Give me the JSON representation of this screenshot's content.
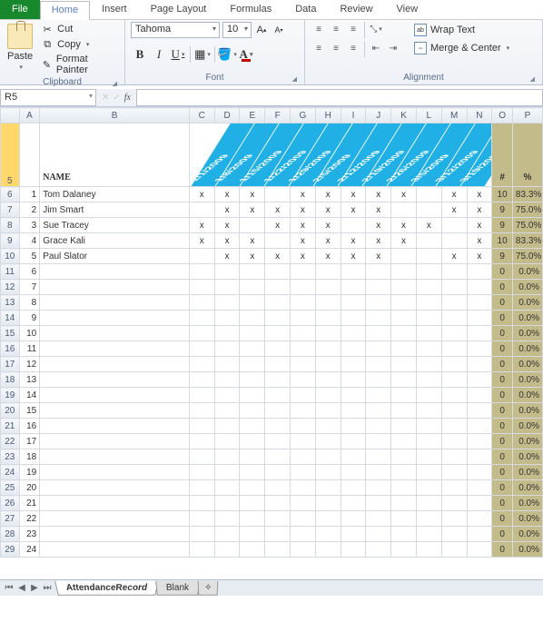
{
  "tabs": {
    "file": "File",
    "home": "Home",
    "insert": "Insert",
    "pagelayout": "Page Layout",
    "formulas": "Formulas",
    "data": "Data",
    "review": "Review",
    "view": "View"
  },
  "clipboard": {
    "paste": "Paste",
    "cut": "Cut",
    "copy": "Copy",
    "format_painter": "Format Painter",
    "group": "Clipboard"
  },
  "font": {
    "name": "Tahoma",
    "size": "10",
    "group": "Font",
    "grow": "A",
    "shrink": "A",
    "bold": "B",
    "italic": "I",
    "underline": "U"
  },
  "alignment": {
    "group": "Alignment",
    "wrap": "Wrap Text",
    "merge": "Merge & Center"
  },
  "namebox": "R5",
  "fx_label": "fx",
  "columns": [
    "A",
    "B",
    "C",
    "D",
    "E",
    "F",
    "G",
    "H",
    "I",
    "J",
    "K",
    "L",
    "M",
    "N",
    "O",
    "P"
  ],
  "header": {
    "name": "NAME",
    "count": "#",
    "pct": "%"
  },
  "dates": [
    "1/1/2009",
    "1/8/2009",
    "1/15/2009",
    "1/22/2009",
    "1/29/2009",
    "2/5/2009",
    "2/12/2009",
    "2/19/2009",
    "2/26/2009",
    "3/5/2009",
    "3/12/2009",
    "3/19/2009"
  ],
  "rows": [
    {
      "n": 1,
      "name": "Tom Dalaney",
      "marks": [
        "x",
        "x",
        "x",
        "",
        "x",
        "x",
        "x",
        "x",
        "x",
        "",
        "x",
        "x"
      ],
      "count": 10,
      "pct": "83.3%"
    },
    {
      "n": 2,
      "name": "Jim Smart",
      "marks": [
        "",
        "x",
        "x",
        "x",
        "x",
        "x",
        "x",
        "x",
        "",
        "",
        "x",
        "x"
      ],
      "count": 9,
      "pct": "75.0%"
    },
    {
      "n": 3,
      "name": "Sue Tracey",
      "marks": [
        "x",
        "x",
        "",
        "x",
        "x",
        "x",
        "",
        "x",
        "x",
        "x",
        "",
        "x"
      ],
      "count": 9,
      "pct": "75.0%"
    },
    {
      "n": 4,
      "name": "Grace Kali",
      "marks": [
        "x",
        "x",
        "x",
        "",
        "x",
        "x",
        "x",
        "x",
        "x",
        "",
        "",
        "x"
      ],
      "count": 10,
      "pct": "83.3%"
    },
    {
      "n": 5,
      "name": "Paul Slator",
      "marks": [
        "",
        "x",
        "x",
        "x",
        "x",
        "x",
        "x",
        "x",
        "",
        "",
        "x",
        "x"
      ],
      "count": 9,
      "pct": "75.0%"
    },
    {
      "n": 6,
      "name": "",
      "marks": [
        "",
        "",
        "",
        "",
        "",
        "",
        "",
        "",
        "",
        "",
        "",
        ""
      ],
      "count": 0,
      "pct": "0.0%"
    },
    {
      "n": 7,
      "name": "",
      "marks": [
        "",
        "",
        "",
        "",
        "",
        "",
        "",
        "",
        "",
        "",
        "",
        ""
      ],
      "count": 0,
      "pct": "0.0%"
    },
    {
      "n": 8,
      "name": "",
      "marks": [
        "",
        "",
        "",
        "",
        "",
        "",
        "",
        "",
        "",
        "",
        "",
        ""
      ],
      "count": 0,
      "pct": "0.0%"
    },
    {
      "n": 9,
      "name": "",
      "marks": [
        "",
        "",
        "",
        "",
        "",
        "",
        "",
        "",
        "",
        "",
        "",
        ""
      ],
      "count": 0,
      "pct": "0.0%"
    },
    {
      "n": 10,
      "name": "",
      "marks": [
        "",
        "",
        "",
        "",
        "",
        "",
        "",
        "",
        "",
        "",
        "",
        ""
      ],
      "count": 0,
      "pct": "0.0%"
    },
    {
      "n": 11,
      "name": "",
      "marks": [
        "",
        "",
        "",
        "",
        "",
        "",
        "",
        "",
        "",
        "",
        "",
        ""
      ],
      "count": 0,
      "pct": "0.0%"
    },
    {
      "n": 12,
      "name": "",
      "marks": [
        "",
        "",
        "",
        "",
        "",
        "",
        "",
        "",
        "",
        "",
        "",
        ""
      ],
      "count": 0,
      "pct": "0.0%"
    },
    {
      "n": 13,
      "name": "",
      "marks": [
        "",
        "",
        "",
        "",
        "",
        "",
        "",
        "",
        "",
        "",
        "",
        ""
      ],
      "count": 0,
      "pct": "0.0%"
    },
    {
      "n": 14,
      "name": "",
      "marks": [
        "",
        "",
        "",
        "",
        "",
        "",
        "",
        "",
        "",
        "",
        "",
        ""
      ],
      "count": 0,
      "pct": "0.0%"
    },
    {
      "n": 15,
      "name": "",
      "marks": [
        "",
        "",
        "",
        "",
        "",
        "",
        "",
        "",
        "",
        "",
        "",
        ""
      ],
      "count": 0,
      "pct": "0.0%"
    },
    {
      "n": 16,
      "name": "",
      "marks": [
        "",
        "",
        "",
        "",
        "",
        "",
        "",
        "",
        "",
        "",
        "",
        ""
      ],
      "count": 0,
      "pct": "0.0%"
    },
    {
      "n": 17,
      "name": "",
      "marks": [
        "",
        "",
        "",
        "",
        "",
        "",
        "",
        "",
        "",
        "",
        "",
        ""
      ],
      "count": 0,
      "pct": "0.0%"
    },
    {
      "n": 18,
      "name": "",
      "marks": [
        "",
        "",
        "",
        "",
        "",
        "",
        "",
        "",
        "",
        "",
        "",
        ""
      ],
      "count": 0,
      "pct": "0.0%"
    },
    {
      "n": 19,
      "name": "",
      "marks": [
        "",
        "",
        "",
        "",
        "",
        "",
        "",
        "",
        "",
        "",
        "",
        ""
      ],
      "count": 0,
      "pct": "0.0%"
    },
    {
      "n": 20,
      "name": "",
      "marks": [
        "",
        "",
        "",
        "",
        "",
        "",
        "",
        "",
        "",
        "",
        "",
        ""
      ],
      "count": 0,
      "pct": "0.0%"
    },
    {
      "n": 21,
      "name": "",
      "marks": [
        "",
        "",
        "",
        "",
        "",
        "",
        "",
        "",
        "",
        "",
        "",
        ""
      ],
      "count": 0,
      "pct": "0.0%"
    },
    {
      "n": 22,
      "name": "",
      "marks": [
        "",
        "",
        "",
        "",
        "",
        "",
        "",
        "",
        "",
        "",
        "",
        ""
      ],
      "count": 0,
      "pct": "0.0%"
    },
    {
      "n": 23,
      "name": "",
      "marks": [
        "",
        "",
        "",
        "",
        "",
        "",
        "",
        "",
        "",
        "",
        "",
        ""
      ],
      "count": 0,
      "pct": "0.0%"
    },
    {
      "n": 24,
      "name": "",
      "marks": [
        "",
        "",
        "",
        "",
        "",
        "",
        "",
        "",
        "",
        "",
        "",
        ""
      ],
      "count": 0,
      "pct": "0.0%"
    }
  ],
  "sheettabs": {
    "active": "AttendanceRecord",
    "other": "Blank"
  }
}
